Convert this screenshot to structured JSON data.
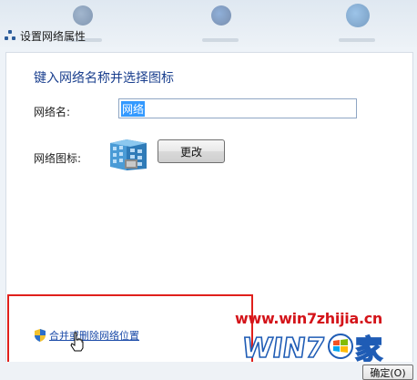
{
  "window": {
    "title": "设置网络属性"
  },
  "dialog": {
    "heading": "键入网络名称并选择图标",
    "network_name": {
      "label": "网络名:",
      "value": "网络"
    },
    "network_icon": {
      "label": "网络图标:",
      "icon": "network-building-icon",
      "change_label": "更改"
    },
    "merge_link": {
      "label": "合并或删除网络位置",
      "icon": "shield-icon"
    }
  },
  "watermark": {
    "url": "www.win7zhijia.cn",
    "logo_text": "WIN7",
    "logo_suffix": "家"
  },
  "footer": {
    "ok_label": "确定(O)"
  },
  "colors": {
    "heading": "#1a3f8e",
    "link": "#1a4aa8",
    "highlight_box": "#e0201c",
    "selection": "#3399ff",
    "watermark_red": "#d4141a"
  }
}
